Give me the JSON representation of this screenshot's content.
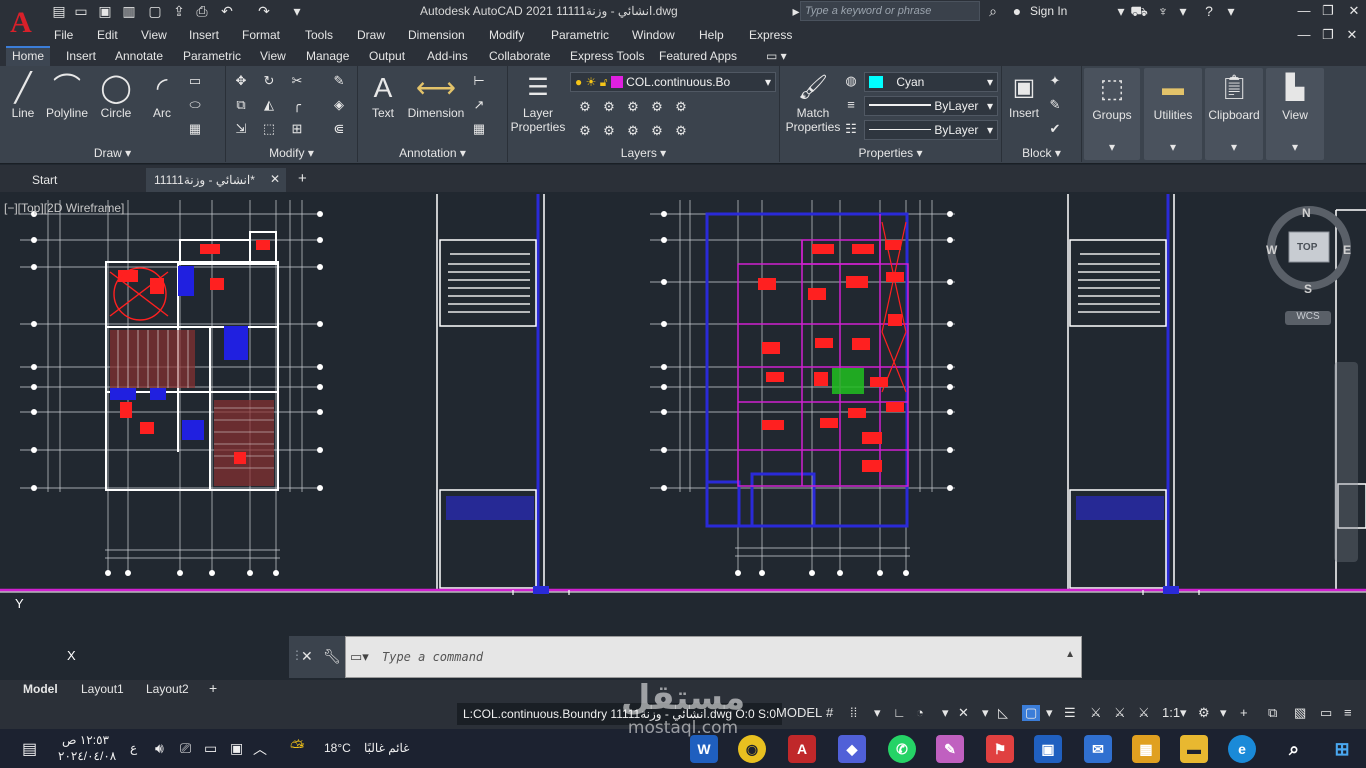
{
  "app": {
    "title": "Autodesk AutoCAD 2021    انشائي - وزنة11111.dwg",
    "logo_letter": "A",
    "search_placeholder": "Type a keyword or phrase",
    "sign_in": "Sign In"
  },
  "menubar": [
    "File",
    "Edit",
    "View",
    "Insert",
    "Format",
    "Tools",
    "Draw",
    "Dimension",
    "Modify",
    "Parametric",
    "Window",
    "Help",
    "Express"
  ],
  "ribbon_tabs": [
    "Home",
    "Insert",
    "Annotate",
    "Parametric",
    "View",
    "Manage",
    "Output",
    "Add-ins",
    "Collaborate",
    "Express Tools",
    "Featured Apps"
  ],
  "ribbon": {
    "draw": {
      "title": "Draw",
      "line": "Line",
      "polyline": "Polyline",
      "circle": "Circle",
      "arc": "Arc"
    },
    "modify": {
      "title": "Modify"
    },
    "annotation": {
      "title": "Annotation",
      "text": "Text",
      "dimension": "Dimension"
    },
    "layers": {
      "title": "Layers",
      "layer_properties": "Layer Properties",
      "current_layer": "COL.continuous.Bo"
    },
    "properties": {
      "title": "Properties",
      "match_properties": "Match Properties",
      "color": "Cyan",
      "lineweight": "ByLayer",
      "linetype": "ByLayer"
    },
    "block": {
      "title": "Block",
      "insert": "Insert"
    },
    "groups": {
      "label": "Groups"
    },
    "utilities": {
      "label": "Utilities"
    },
    "clipboard": {
      "label": "Clipboard"
    },
    "view": {
      "label": "View"
    }
  },
  "file_tabs": {
    "start": "Start",
    "current": "انشائي - وزنة11111*"
  },
  "viewport": {
    "label": "[−][Top][2D Wireframe]",
    "viewcube_top": "TOP",
    "compass": {
      "n": "N",
      "s": "S",
      "e": "E",
      "w": "W"
    },
    "wcs": "WCS",
    "ucs_y": "Y",
    "ucs_x": "X"
  },
  "command": {
    "placeholder": "Type  a  command"
  },
  "layout_tabs": [
    "Model",
    "Layout1",
    "Layout2"
  ],
  "status": {
    "file_info": "L:COL.continuous.Boundry انشائي - وزنة11111.dwg O:0 S:0",
    "model": "MODEL",
    "scale": "1:1"
  },
  "taskbar": {
    "time": "١٢:٥٣ ص",
    "date": "٢٠٢٤/٠٤/٠٨",
    "lang": "ع",
    "weather_temp": "18°C",
    "weather_text": "غائم غالبًا"
  },
  "watermark": {
    "arabic": "مستقل",
    "latin": "mostaql.com"
  },
  "colors": {
    "accent": "#3b7dd8",
    "background": "#212830",
    "ribbon": "#3b434d"
  }
}
